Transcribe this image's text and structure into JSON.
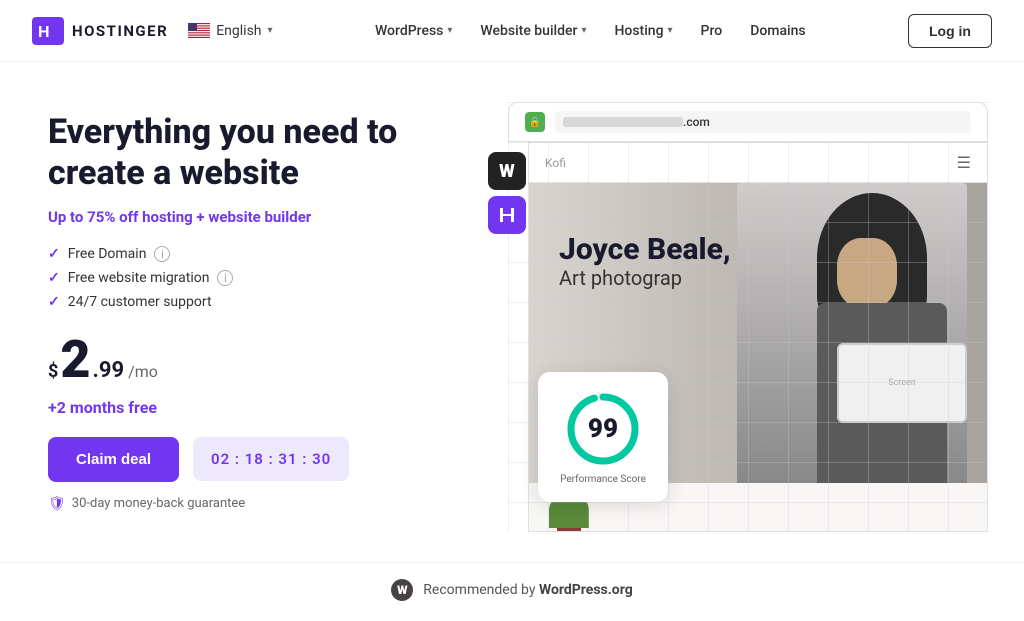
{
  "logo": {
    "text": "HOSTINGER",
    "icon_label": "H"
  },
  "language": {
    "label": "English"
  },
  "nav": {
    "items": [
      {
        "label": "WordPress",
        "has_dropdown": true
      },
      {
        "label": "Website builder",
        "has_dropdown": true
      },
      {
        "label": "Hosting",
        "has_dropdown": true
      },
      {
        "label": "Pro",
        "has_dropdown": false
      },
      {
        "label": "Domains",
        "has_dropdown": false
      }
    ],
    "login_label": "Log in"
  },
  "hero": {
    "headline": "Everything you need to create a website",
    "subheadline_prefix": "Up to ",
    "discount": "75%",
    "subheadline_suffix": " off hosting + website builder",
    "features": [
      {
        "text": "Free Domain",
        "has_info": true
      },
      {
        "text": "Free website migration",
        "has_info": true
      },
      {
        "text": "24/7 customer support",
        "has_info": false
      }
    ],
    "price": {
      "dollar": "$",
      "main": "2",
      "decimal": ".99",
      "period": "/mo"
    },
    "months_free": "+2 months free",
    "cta_label": "Claim deal",
    "timer": "02 : 18 : 31 : 30",
    "guarantee": "30-day money-back guarantee"
  },
  "illustration": {
    "url_bar": ".com",
    "preview_name": "Kofi",
    "hero_name": "Joyce Beale,",
    "hero_subtitle": "Art photograp",
    "perf_score": "99",
    "perf_label": "Performance\nScore",
    "wp_icon": "W",
    "h_icon": "H"
  },
  "footer": {
    "text": "Recommended by ",
    "brand": "WordPress.org"
  }
}
